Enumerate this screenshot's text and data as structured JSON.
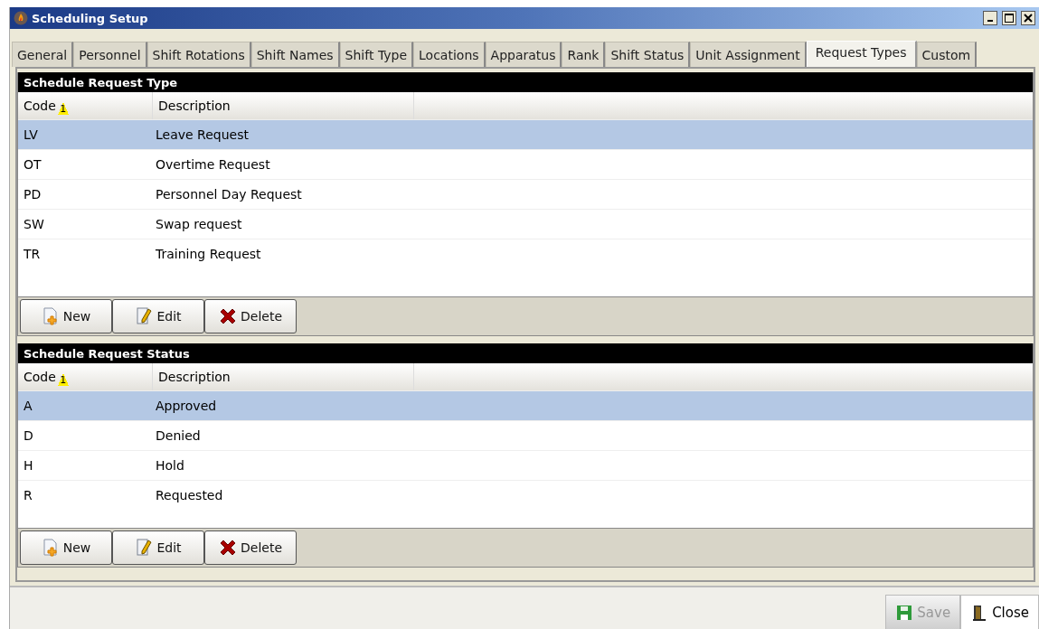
{
  "window": {
    "title": "Scheduling Setup"
  },
  "tabs": [
    {
      "label": "General",
      "selected": false
    },
    {
      "label": "Personnel",
      "selected": false
    },
    {
      "label": "Shift Rotations",
      "selected": false
    },
    {
      "label": "Shift Names",
      "selected": false
    },
    {
      "label": "Shift Type",
      "selected": false
    },
    {
      "label": "Locations",
      "selected": false
    },
    {
      "label": "Apparatus",
      "selected": false
    },
    {
      "label": "Rank",
      "selected": false
    },
    {
      "label": "Shift Status",
      "selected": false
    },
    {
      "label": "Unit Assignment",
      "selected": false
    },
    {
      "label": "Request Types",
      "selected": true
    },
    {
      "label": "Custom",
      "selected": false
    }
  ],
  "panels": [
    {
      "title": "Schedule Request Type",
      "columns": [
        {
          "label": "Code",
          "sort_index": "1"
        },
        {
          "label": "Description"
        }
      ],
      "rows": [
        {
          "cells": [
            "LV",
            "Leave Request"
          ],
          "selected": true
        },
        {
          "cells": [
            "OT",
            "Overtime Request"
          ],
          "selected": false
        },
        {
          "cells": [
            "PD",
            "Personnel Day Request"
          ],
          "selected": false
        },
        {
          "cells": [
            "SW",
            "Swap request"
          ],
          "selected": false
        },
        {
          "cells": [
            "TR",
            "Training Request"
          ],
          "selected": false
        }
      ],
      "buttons": [
        {
          "kind": "new",
          "label": "New"
        },
        {
          "kind": "edit",
          "label": "Edit"
        },
        {
          "kind": "delete",
          "label": "Delete"
        }
      ]
    },
    {
      "title": "Schedule Request Status",
      "columns": [
        {
          "label": "Code",
          "sort_index": "1"
        },
        {
          "label": "Description"
        }
      ],
      "rows": [
        {
          "cells": [
            "A",
            "Approved"
          ],
          "selected": true
        },
        {
          "cells": [
            "D",
            "Denied"
          ],
          "selected": false
        },
        {
          "cells": [
            "H",
            "Hold"
          ],
          "selected": false
        },
        {
          "cells": [
            "R",
            "Requested"
          ],
          "selected": false
        }
      ],
      "buttons": [
        {
          "kind": "new",
          "label": "New"
        },
        {
          "kind": "edit",
          "label": "Edit"
        },
        {
          "kind": "delete",
          "label": "Delete"
        }
      ]
    }
  ],
  "footer_buttons": [
    {
      "kind": "save",
      "label": "Save",
      "disabled": true
    },
    {
      "kind": "close",
      "label": "Close",
      "disabled": false
    }
  ]
}
